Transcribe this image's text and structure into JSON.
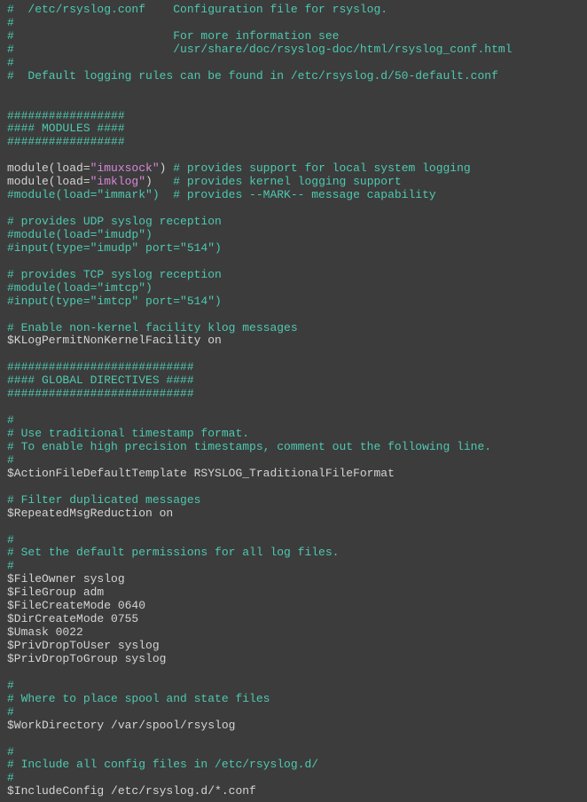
{
  "lines": [
    [
      {
        "c": "cyan",
        "t": "#  /etc/rsyslog.conf    Configuration file for rsyslog."
      }
    ],
    [
      {
        "c": "cyan",
        "t": "#"
      }
    ],
    [
      {
        "c": "cyan",
        "t": "#                       For more information see"
      }
    ],
    [
      {
        "c": "cyan",
        "t": "#                       /usr/share/doc/rsyslog-doc/html/rsyslog_conf.html"
      }
    ],
    [
      {
        "c": "cyan",
        "t": "#"
      }
    ],
    [
      {
        "c": "cyan",
        "t": "#  Default logging rules can be found in /etc/rsyslog.d/50-default.conf"
      }
    ],
    [
      {
        "c": "cyan",
        "t": ""
      }
    ],
    [
      {
        "c": "cyan",
        "t": ""
      }
    ],
    [
      {
        "c": "cyan",
        "t": "#################"
      }
    ],
    [
      {
        "c": "cyan",
        "t": "#### MODULES ####"
      }
    ],
    [
      {
        "c": "cyan",
        "t": "#################"
      }
    ],
    [
      {
        "c": "cyan",
        "t": ""
      }
    ],
    [
      {
        "c": "white",
        "t": "module(load="
      },
      {
        "c": "magenta",
        "t": "\"imuxsock\""
      },
      {
        "c": "white",
        "t": ") "
      },
      {
        "c": "cyan",
        "t": "# provides support for local system logging"
      }
    ],
    [
      {
        "c": "white",
        "t": "module(load="
      },
      {
        "c": "magenta",
        "t": "\"imklog\""
      },
      {
        "c": "white",
        "t": ")   "
      },
      {
        "c": "cyan",
        "t": "# provides kernel logging support"
      }
    ],
    [
      {
        "c": "cyan",
        "t": "#module(load=\"immark\")  # provides --MARK-- message capability"
      }
    ],
    [
      {
        "c": "cyan",
        "t": ""
      }
    ],
    [
      {
        "c": "cyan",
        "t": "# provides UDP syslog reception"
      }
    ],
    [
      {
        "c": "cyan",
        "t": "#module(load=\"imudp\")"
      }
    ],
    [
      {
        "c": "cyan",
        "t": "#input(type=\"imudp\" port=\"514\")"
      }
    ],
    [
      {
        "c": "cyan",
        "t": ""
      }
    ],
    [
      {
        "c": "cyan",
        "t": "# provides TCP syslog reception"
      }
    ],
    [
      {
        "c": "cyan",
        "t": "#module(load=\"imtcp\")"
      }
    ],
    [
      {
        "c": "cyan",
        "t": "#input(type=\"imtcp\" port=\"514\")"
      }
    ],
    [
      {
        "c": "cyan",
        "t": ""
      }
    ],
    [
      {
        "c": "cyan",
        "t": "# Enable non-kernel facility klog messages"
      }
    ],
    [
      {
        "c": "white",
        "t": "$KLogPermitNonKernelFacility on"
      }
    ],
    [
      {
        "c": "cyan",
        "t": ""
      }
    ],
    [
      {
        "c": "cyan",
        "t": "###########################"
      }
    ],
    [
      {
        "c": "cyan",
        "t": "#### GLOBAL DIRECTIVES ####"
      }
    ],
    [
      {
        "c": "cyan",
        "t": "###########################"
      }
    ],
    [
      {
        "c": "cyan",
        "t": ""
      }
    ],
    [
      {
        "c": "cyan",
        "t": "#"
      }
    ],
    [
      {
        "c": "cyan",
        "t": "# Use traditional timestamp format."
      }
    ],
    [
      {
        "c": "cyan",
        "t": "# To enable high precision timestamps, comment out the following line."
      }
    ],
    [
      {
        "c": "cyan",
        "t": "#"
      }
    ],
    [
      {
        "c": "white",
        "t": "$ActionFileDefaultTemplate RSYSLOG_TraditionalFileFormat"
      }
    ],
    [
      {
        "c": "cyan",
        "t": ""
      }
    ],
    [
      {
        "c": "cyan",
        "t": "# Filter duplicated messages"
      }
    ],
    [
      {
        "c": "white",
        "t": "$RepeatedMsgReduction on"
      }
    ],
    [
      {
        "c": "cyan",
        "t": ""
      }
    ],
    [
      {
        "c": "cyan",
        "t": "#"
      }
    ],
    [
      {
        "c": "cyan",
        "t": "# Set the default permissions for all log files."
      }
    ],
    [
      {
        "c": "cyan",
        "t": "#"
      }
    ],
    [
      {
        "c": "white",
        "t": "$FileOwner syslog"
      }
    ],
    [
      {
        "c": "white",
        "t": "$FileGroup adm"
      }
    ],
    [
      {
        "c": "white",
        "t": "$FileCreateMode 0640"
      }
    ],
    [
      {
        "c": "white",
        "t": "$DirCreateMode 0755"
      }
    ],
    [
      {
        "c": "white",
        "t": "$Umask 0022"
      }
    ],
    [
      {
        "c": "white",
        "t": "$PrivDropToUser syslog"
      }
    ],
    [
      {
        "c": "white",
        "t": "$PrivDropToGroup syslog"
      }
    ],
    [
      {
        "c": "cyan",
        "t": ""
      }
    ],
    [
      {
        "c": "cyan",
        "t": "#"
      }
    ],
    [
      {
        "c": "cyan",
        "t": "# Where to place spool and state files"
      }
    ],
    [
      {
        "c": "cyan",
        "t": "#"
      }
    ],
    [
      {
        "c": "white",
        "t": "$WorkDirectory /var/spool/rsyslog"
      }
    ],
    [
      {
        "c": "cyan",
        "t": ""
      }
    ],
    [
      {
        "c": "cyan",
        "t": "#"
      }
    ],
    [
      {
        "c": "cyan",
        "t": "# Include all config files in /etc/rsyslog.d/"
      }
    ],
    [
      {
        "c": "cyan",
        "t": "#"
      }
    ],
    [
      {
        "c": "white",
        "t": "$IncludeConfig /etc/rsyslog.d/*.conf"
      }
    ]
  ]
}
